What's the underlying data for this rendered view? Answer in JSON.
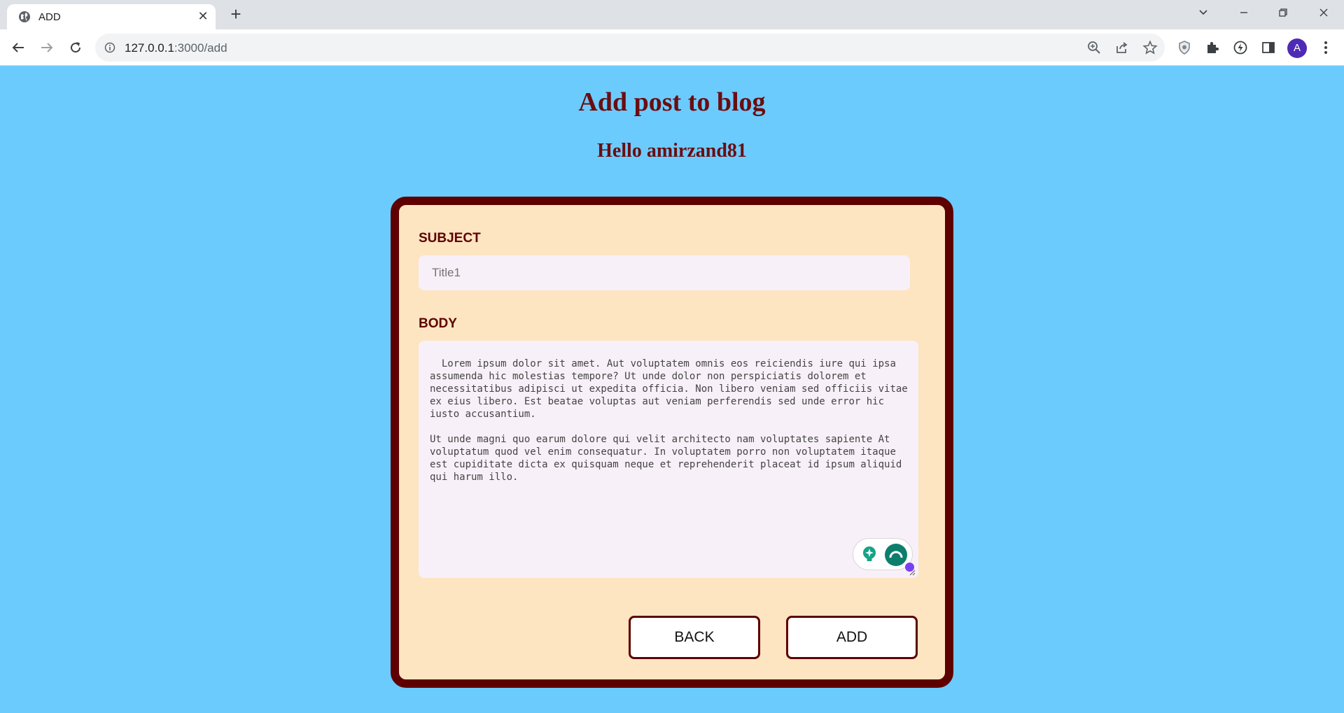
{
  "browser": {
    "tab_title": "ADD",
    "url_host": "127.0.0.1",
    "url_path": ":3000/add",
    "profile_initial": "A"
  },
  "page": {
    "title": "Add post to blog",
    "greeting": "Hello amirzand81"
  },
  "form": {
    "subject_label": "SUBJECT",
    "subject_placeholder": "Title1",
    "subject_value": "",
    "body_label": "BODY",
    "body_value": "  Lorem ipsum dolor sit amet. Aut voluptatem omnis eos reiciendis iure qui ipsa assumenda hic molestias tempore? Ut unde dolor non perspiciatis dolorem et necessitatibus adipisci ut expedita officia. Non libero veniam sed officiis vitae ex eius libero. Est beatae voluptas aut veniam perferendis sed unde error hic iusto accusantium.\n\nUt unde magni quo earum dolore qui velit architecto nam voluptates sapiente At voluptatum quod vel enim consequatur. In voluptatem porro non voluptatem itaque est cupiditate dicta ex quisquam neque et reprehenderit placeat id ipsum aliquid qui harum illo.",
    "back_label": "BACK",
    "add_label": "ADD"
  },
  "colors": {
    "page_background": "#6ccbfd",
    "card_background": "#fde5c2",
    "accent_dark_red": "#5f0000",
    "heading_red": "#6b0d10",
    "input_background": "#f8f0f8"
  },
  "icons": {
    "tab": "globe-icon",
    "toolbar": [
      "back-arrow-icon",
      "forward-arrow-icon",
      "reload-icon",
      "info-icon",
      "zoom-icon",
      "share-icon",
      "star-icon",
      "shield-extension-icon",
      "puzzle-extensions-icon",
      "lightning-extension-icon",
      "side-panel-icon",
      "menu-dots-icon"
    ],
    "editor": [
      "grammarly-bulb-icon",
      "grammarly-logo-icon"
    ]
  }
}
